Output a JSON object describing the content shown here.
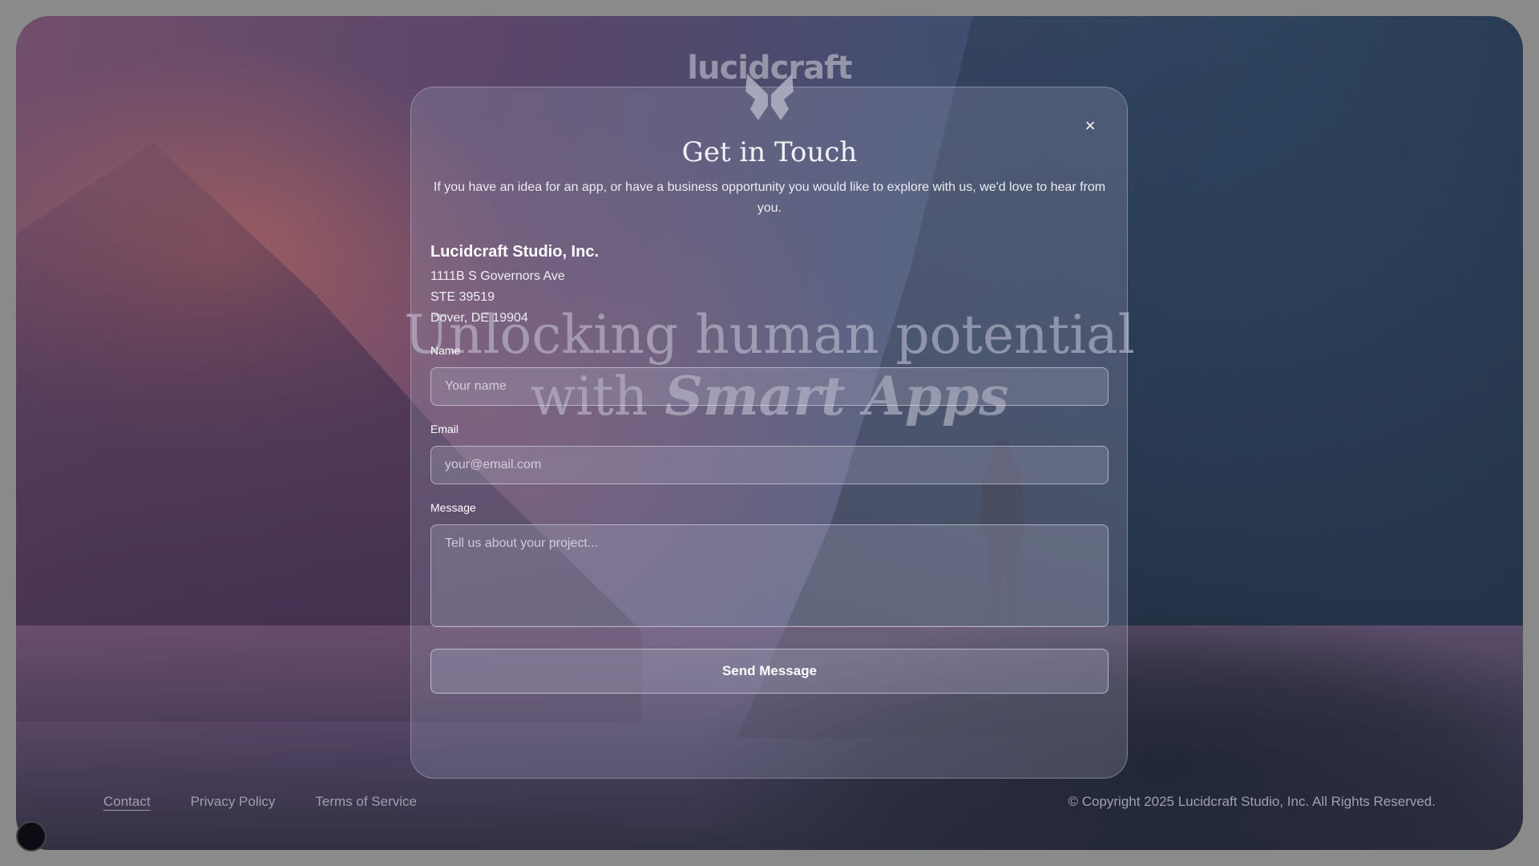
{
  "hero": {
    "line1": "Unlocking human potential",
    "line2_prefix": "with ",
    "line2_emphasis": "Smart Apps"
  },
  "footer": {
    "links": [
      "Contact",
      "Privacy Policy",
      "Terms of Service"
    ],
    "copyright": "© Copyright 2025 Lucidcraft Studio, Inc. All Rights Reserved."
  },
  "logo": {
    "text": "lucidcraft",
    "icon": "butterfly-icon"
  },
  "modal": {
    "title": "Get in Touch",
    "close_icon": "close-icon",
    "close_label": "×",
    "subtitle": "If you have an idea for an app, or have a business opportunity you would like to explore with us, we'd love to hear from you.",
    "company": {
      "name": "Lucidcraft Studio, Inc.",
      "address_line1": "1111B S Governors Ave",
      "address_line2": "STE 39519",
      "address_line3": "Dover, DE 19904"
    },
    "form": {
      "name_label": "Name",
      "name_placeholder": "Your name",
      "name_value": "",
      "email_label": "Email",
      "email_placeholder": "your@email.com",
      "email_value": "",
      "message_label": "Message",
      "message_placeholder": "Tell us about your project...",
      "message_value": "",
      "submit_label": "Send Message"
    }
  }
}
